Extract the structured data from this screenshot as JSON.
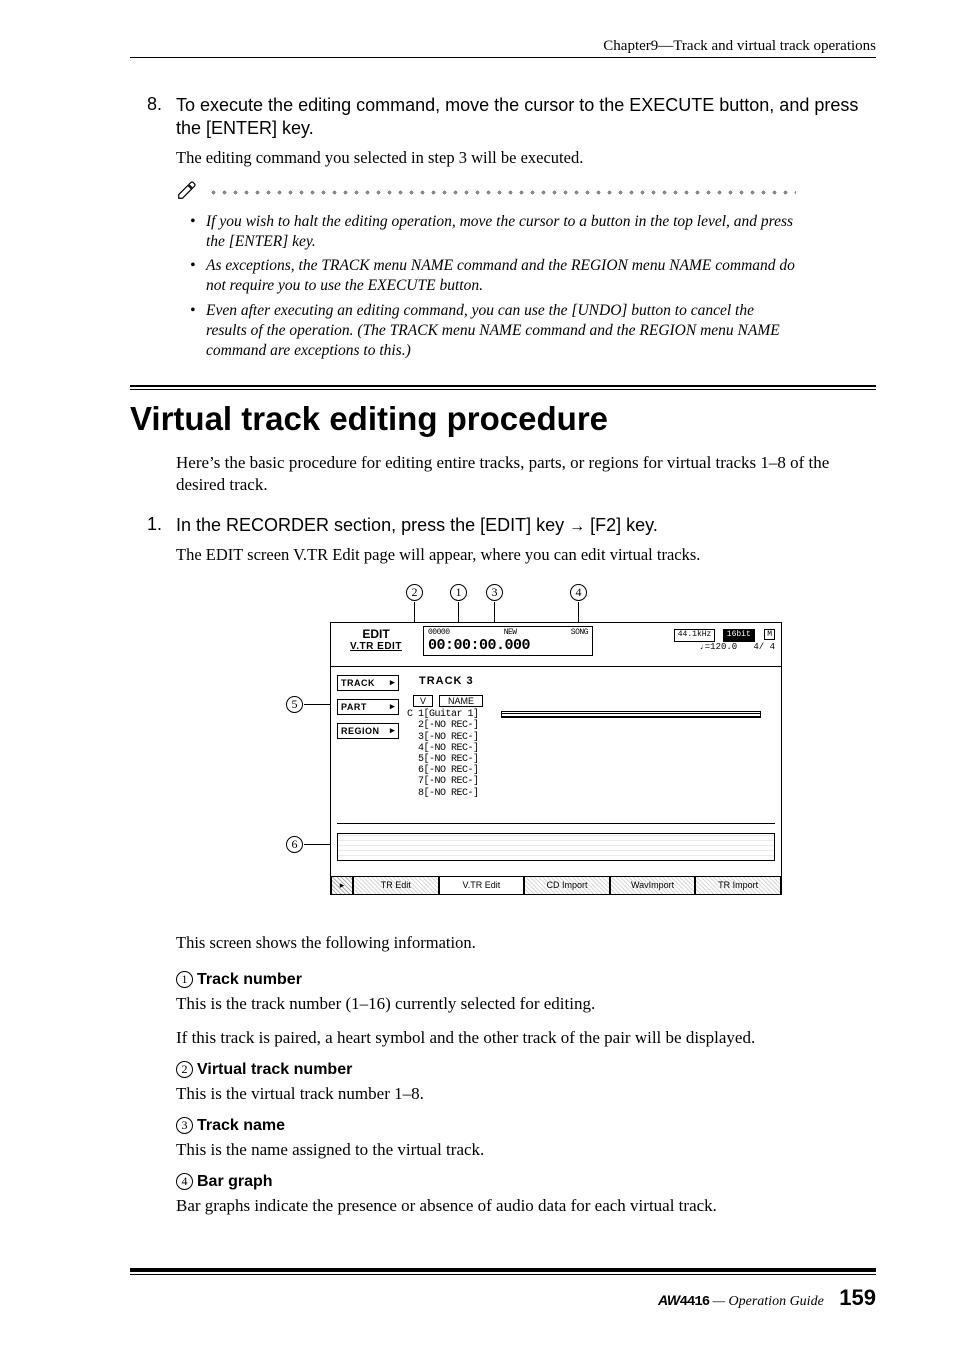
{
  "header": {
    "chapter": "Chapter9—Track and virtual track operations"
  },
  "step8": {
    "number": "8.",
    "text": "To execute the editing command, move the cursor to the EXECUTE button, and press the [ENTER] key.",
    "body": "The editing command you selected in step 3 will be executed.",
    "notes": [
      "If you wish to halt the editing operation, move the cursor to a button in the top level, and press the [ENTER] key.",
      "As exceptions, the TRACK menu NAME command and the REGION menu NAME command do not require you to use the EXECUTE button.",
      "Even after executing an editing command, you can use the [UNDO] button to cancel the results of the operation. (The TRACK menu NAME command and the REGION menu NAME command are exceptions to this.)"
    ]
  },
  "section": {
    "title": "Virtual track editing procedure",
    "intro": "Here’s the basic procedure for editing entire tracks, parts, or regions for virtual tracks 1–8 of the desired track."
  },
  "step1": {
    "number": "1.",
    "prefix": "In the RECORDER section, press the [EDIT] key ",
    "arrow": "→",
    "suffix": " [F2] key.",
    "body": "The EDIT screen V.TR Edit page will appear, where you can edit virtual tracks."
  },
  "figure": {
    "title": "EDIT",
    "subtitle": "V.TR EDIT",
    "counter_small_left": "00000",
    "counter_small_mid": "NEW",
    "counter_small_right": "SONG",
    "counter_big": "00:00:00.000",
    "status_rate": "44.1kHz",
    "status_bits": "16bit",
    "status_tempo": "♩=120.0",
    "status_sig": "4/ 4",
    "sidebar": [
      "TRACK",
      "PART",
      "REGION"
    ],
    "tracklabel": "TRACK 3",
    "th_v": "V",
    "th_name": "NAME",
    "rows": "C 1[Guitar 1]\n  2[-NO REC-]\n  3[-NO REC-]\n  4[-NO REC-]\n  5[-NO REC-]\n  6[-NO REC-]\n  7[-NO REC-]\n  8[-NO REC-]",
    "tabs": [
      "TR Edit",
      "V.TR Edit",
      "CD Import",
      "WavImport",
      "TR Import"
    ],
    "callouts": {
      "c1": "1",
      "c2": "2",
      "c3": "3",
      "c4": "4",
      "c5": "5",
      "c6": "6"
    }
  },
  "screen_intro": "This screen shows the following information.",
  "defs": [
    {
      "n": "1",
      "h": "Track number",
      "b1": "This is the track number (1–16) currently selected for editing.",
      "b2": "If this track is paired, a heart symbol and the other track of the pair will be displayed."
    },
    {
      "n": "2",
      "h": "Virtual track number",
      "b1": "This is the virtual track number 1–8."
    },
    {
      "n": "3",
      "h": "Track name",
      "b1": "This is the name assigned to the virtual track."
    },
    {
      "n": "4",
      "h": "Bar graph",
      "b1": "Bar graphs indicate the presence or absence of audio data for each virtual track."
    }
  ],
  "footer": {
    "logo_pre": "AW",
    "logo_model": "4416",
    "guide": " — Operation Guide",
    "page": "159"
  }
}
